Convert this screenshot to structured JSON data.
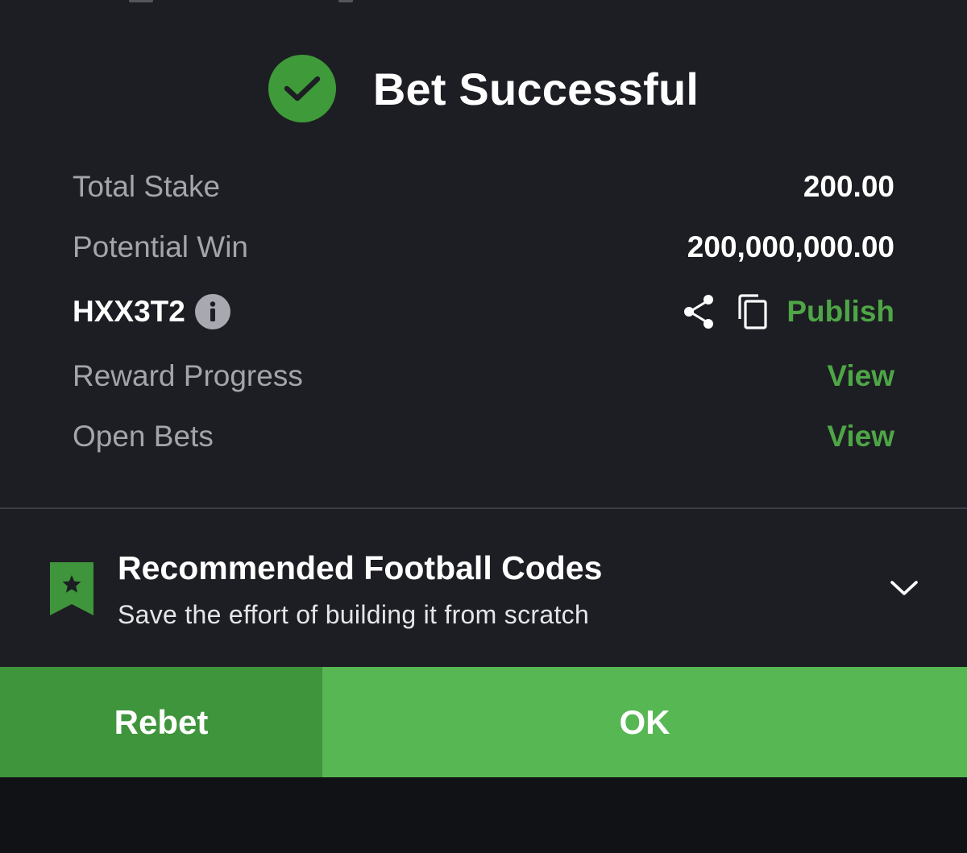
{
  "dialog": {
    "title": "Bet Successful",
    "rows": {
      "total_stake": {
        "label": "Total Stake",
        "value": "200.00"
      },
      "potential_win": {
        "label": "Potential Win",
        "value": "200,000,000.00"
      },
      "booking_code": {
        "code": "HXX3T2",
        "publish_label": "Publish"
      },
      "reward_progress": {
        "label": "Reward Progress",
        "link": "View"
      },
      "open_bets": {
        "label": "Open Bets",
        "link": "View"
      }
    }
  },
  "recommended": {
    "title": "Recommended Football Codes",
    "subtitle": "Save the effort of building it from scratch"
  },
  "buttons": {
    "rebet": "Rebet",
    "ok": "OK"
  },
  "colors": {
    "accent_green": "#4ea646",
    "button_dark_green": "#3f953b",
    "button_green": "#56b753",
    "background": "#1d1e23"
  },
  "icons": [
    "check-circle-icon",
    "info-icon",
    "share-icon",
    "copy-icon",
    "bookmark-star-icon",
    "chevron-down-icon"
  ]
}
